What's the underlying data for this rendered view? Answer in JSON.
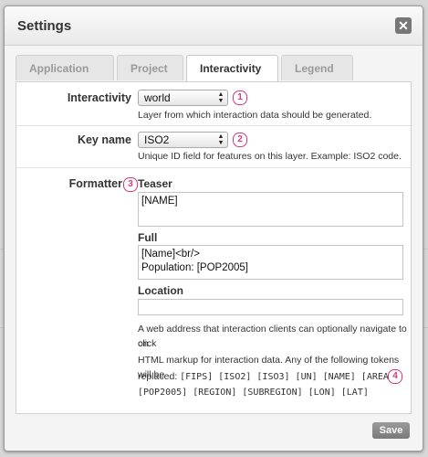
{
  "dialog": {
    "title": "Settings",
    "close_label": "✕",
    "tabs": [
      {
        "label": "Application"
      },
      {
        "label": "Project"
      },
      {
        "label": "Interactivity"
      },
      {
        "label": "Legend"
      }
    ],
    "active_tab": "Interactivity",
    "save_label": "Save"
  },
  "form": {
    "interactivity": {
      "label": "Interactivity",
      "value": "world",
      "help": "Layer from which interaction data should be generated.",
      "badge": "1"
    },
    "key_name": {
      "label": "Key name",
      "value": "ISO2",
      "help": "Unique ID field for features on this layer. Example: ISO2 code.",
      "badge": "2"
    },
    "formatter": {
      "label": "Formatter",
      "badge": "3",
      "teaser_label": "Teaser",
      "teaser_value": "[NAME]",
      "full_label": "Full",
      "full_value": "[Name]<br/>\nPopulation: [POP2005]",
      "location_label": "Location",
      "location_value": "",
      "location_help_1": "A web address that interaction clients can optionally navigate to on",
      "location_help_2": "click",
      "tokens_help_1": "HTML markup for interaction data. Any of the following tokens will be",
      "tokens_help_2_prefix": "replaced:",
      "tokens_line_1": "[FIPS] [ISO2] [ISO3] [UN] [NAME] [AREA]",
      "tokens_line_2": "[POP2005] [REGION] [SUBREGION] [LON] [LAT]",
      "badge_4": "4"
    }
  },
  "colors": {
    "badge": "#d23c7d",
    "save_button": "#888888"
  }
}
